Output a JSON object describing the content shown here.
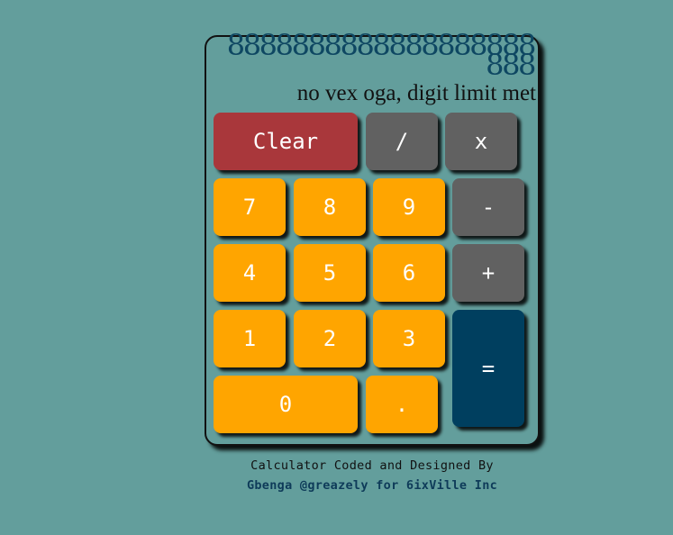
{
  "calculator": {
    "display": "8888888888888888888888",
    "message": "no vex oga, digit limit met",
    "buttons": {
      "clear": "Clear",
      "divide": "/",
      "multiply": "x",
      "seven": "7",
      "eight": "8",
      "nine": "9",
      "minus": "-",
      "four": "4",
      "five": "5",
      "six": "6",
      "plus": "+",
      "one": "1",
      "two": "2",
      "three": "3",
      "equals": "=",
      "zero": "0",
      "decimal": "."
    }
  },
  "footer": {
    "line1": "Calculator Coded and Designed By",
    "line2": "Gbenga @greazely for 6ixVille Inc"
  },
  "colors": {
    "background": "#639e9c",
    "digit_button": "#ffa500",
    "operator_button": "#616161",
    "clear_button": "#a9373b",
    "equals_button": "#003f5f",
    "display_text": "#0e4762"
  }
}
